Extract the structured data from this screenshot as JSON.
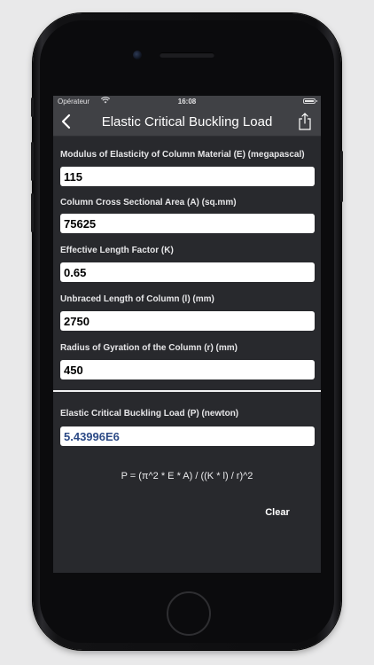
{
  "status_bar": {
    "carrier": "Opérateur",
    "time": "16:08"
  },
  "nav": {
    "title": "Elastic Critical Buckling Load",
    "back_icon": "chevron-left-icon",
    "share_icon": "share-icon"
  },
  "fields": [
    {
      "label": "Modulus of Elasticity of Column Material (E) (megapascal)",
      "value": "115"
    },
    {
      "label": "Column Cross Sectional Area (A) (sq.mm)",
      "value": "75625"
    },
    {
      "label": "Effective Length Factor (K)",
      "value": "0.65"
    },
    {
      "label": "Unbraced Length of Column (l) (mm)",
      "value": "2750"
    },
    {
      "label": "Radius of Gyration of the Column (r) (mm)",
      "value": "450"
    }
  ],
  "result": {
    "label": "Elastic Critical Buckling Load (P) (newton)",
    "value": "5.43996E6"
  },
  "formula": "P = (π^2 * E * A) / ((K * l) / r)^2",
  "clear_label": "Clear",
  "colors": {
    "screen_bg": "#28292d",
    "nav_bg": "#404145",
    "result_text": "#2c4a86"
  }
}
